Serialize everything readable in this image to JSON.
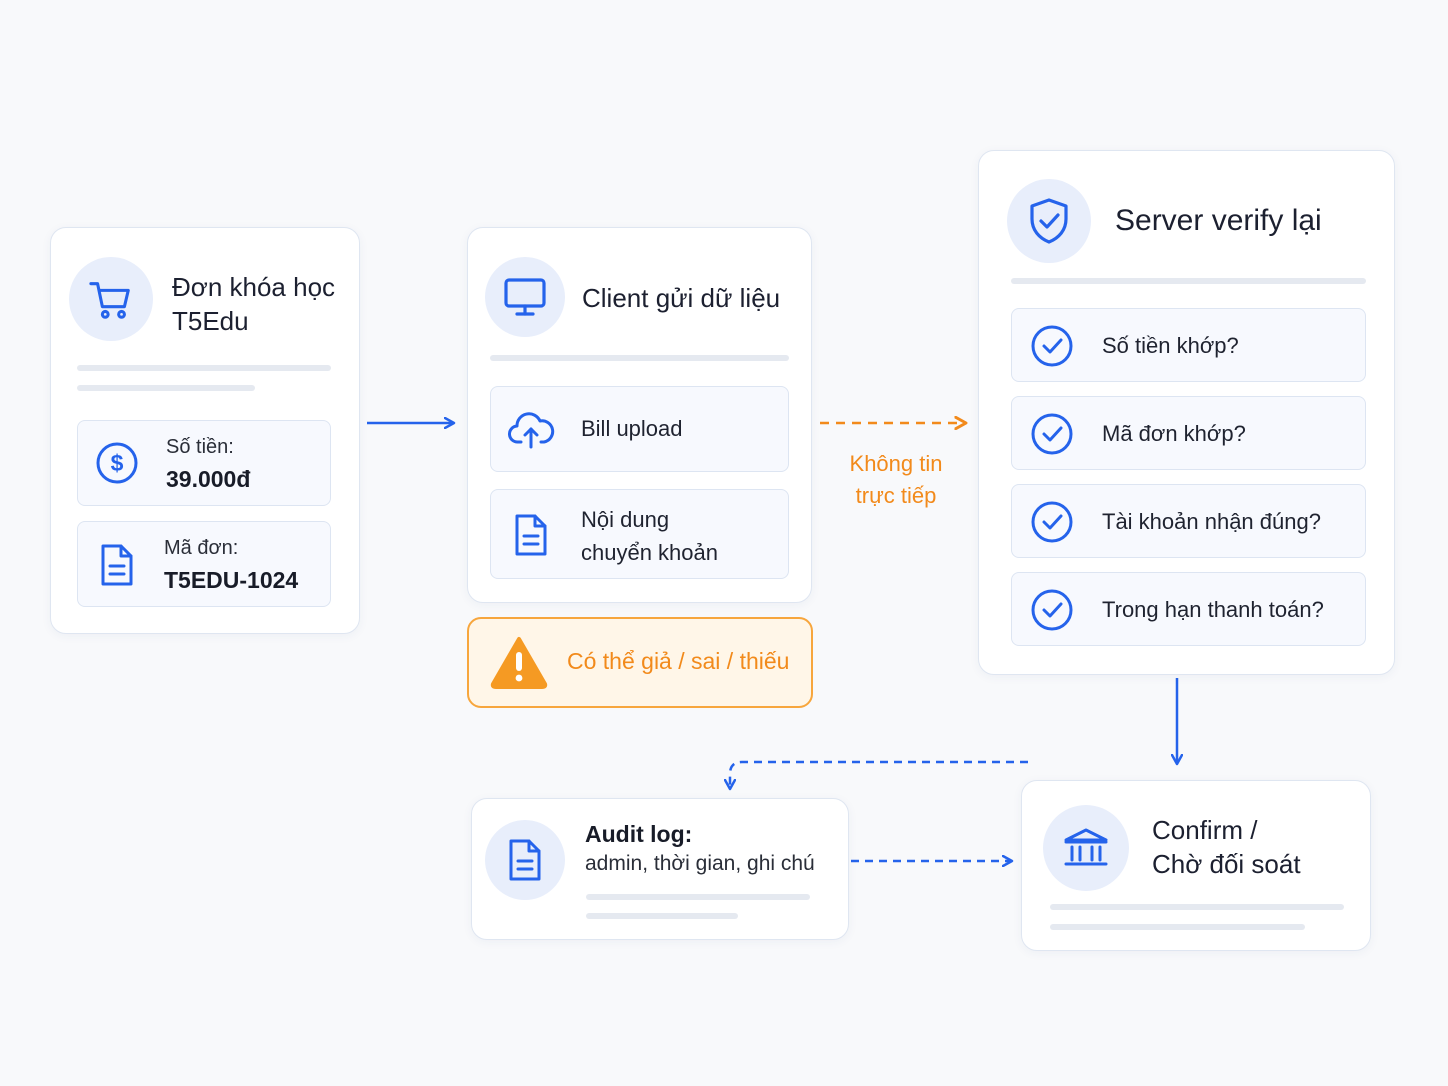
{
  "order": {
    "title_line1": "Đơn khóa học",
    "title_line2": "T5Edu",
    "amount_label": "Số tiền:",
    "amount_value": "39.000đ",
    "code_label": "Mã đơn:",
    "code_value": "T5EDU-1024"
  },
  "client": {
    "title": "Client gửi dữ liệu",
    "items": [
      {
        "label": "Bill upload"
      },
      {
        "line1": "Nội dung",
        "line2": "chuyển khoản"
      }
    ]
  },
  "warning": {
    "text": "Có thể giả / sai / thiếu"
  },
  "arrow_note": {
    "line1": "Không tin",
    "line2": "trực tiếp"
  },
  "server": {
    "title": "Server verify lại",
    "checks": [
      "Số tiền khớp?",
      "Mã đơn khớp?",
      "Tài khoản nhận đúng?",
      "Trong hạn thanh toán?"
    ]
  },
  "audit": {
    "title": "Audit log:",
    "detail": "admin, thời gian, ghi chú"
  },
  "confirm": {
    "line1": "Confirm /",
    "line2": "Chờ đối soát"
  },
  "colors": {
    "accent": "#2563eb",
    "warning": "#f28a1b",
    "warning_bg": "#fff6e8",
    "icon_bg": "#e8eefb"
  },
  "icons": [
    "cart-icon",
    "dollar-icon",
    "document-icon",
    "monitor-icon",
    "cloud-upload-icon",
    "shield-check-icon",
    "check-circle-icon",
    "warning-icon",
    "bank-icon"
  ]
}
